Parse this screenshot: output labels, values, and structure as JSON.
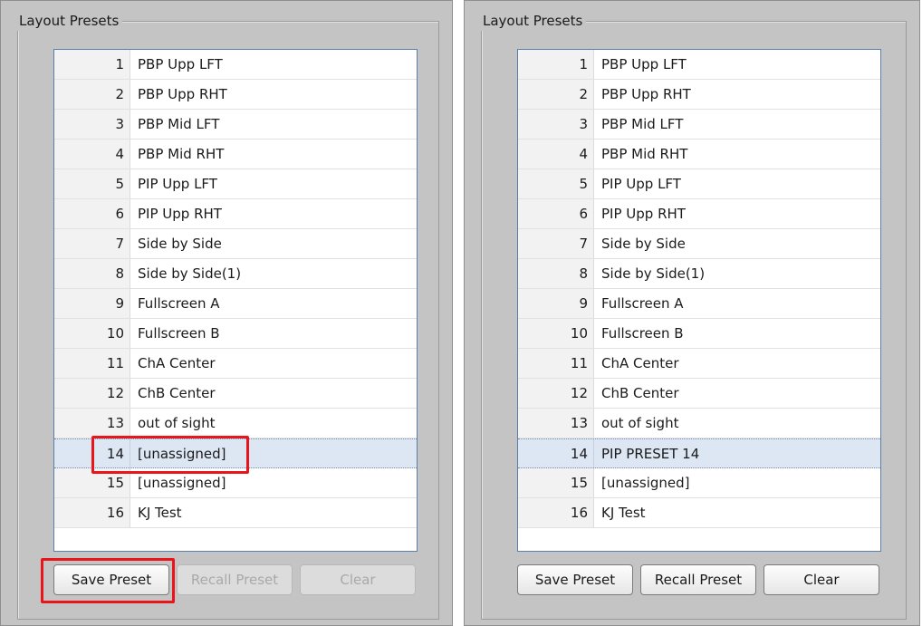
{
  "left_panel": {
    "group_title": "Layout Presets",
    "presets": [
      {
        "num": "1",
        "name": "PBP Upp LFT"
      },
      {
        "num": "2",
        "name": "PBP Upp RHT"
      },
      {
        "num": "3",
        "name": "PBP Mid LFT"
      },
      {
        "num": "4",
        "name": "PBP Mid RHT"
      },
      {
        "num": "5",
        "name": "PIP Upp LFT"
      },
      {
        "num": "6",
        "name": "PIP Upp RHT"
      },
      {
        "num": "7",
        "name": "Side by Side"
      },
      {
        "num": "8",
        "name": "Side by Side(1)"
      },
      {
        "num": "9",
        "name": "Fullscreen A"
      },
      {
        "num": "10",
        "name": "Fullscreen B"
      },
      {
        "num": "11",
        "name": "ChA Center"
      },
      {
        "num": "12",
        "name": "ChB Center"
      },
      {
        "num": "13",
        "name": "out of sight"
      },
      {
        "num": "14",
        "name": "[unassigned]"
      },
      {
        "num": "15",
        "name": "[unassigned]"
      },
      {
        "num": "16",
        "name": "KJ Test"
      }
    ],
    "selected_row": "14",
    "buttons": {
      "save": "Save Preset",
      "recall": "Recall Preset",
      "clear": "Clear"
    },
    "recall_enabled": false,
    "clear_enabled": false
  },
  "right_panel": {
    "group_title": "Layout Presets",
    "presets": [
      {
        "num": "1",
        "name": "PBP Upp LFT"
      },
      {
        "num": "2",
        "name": "PBP Upp RHT"
      },
      {
        "num": "3",
        "name": "PBP Mid LFT"
      },
      {
        "num": "4",
        "name": "PBP Mid RHT"
      },
      {
        "num": "5",
        "name": "PIP Upp LFT"
      },
      {
        "num": "6",
        "name": "PIP Upp RHT"
      },
      {
        "num": "7",
        "name": "Side by Side"
      },
      {
        "num": "8",
        "name": "Side by Side(1)"
      },
      {
        "num": "9",
        "name": "Fullscreen A"
      },
      {
        "num": "10",
        "name": "Fullscreen B"
      },
      {
        "num": "11",
        "name": "ChA Center"
      },
      {
        "num": "12",
        "name": "ChB Center"
      },
      {
        "num": "13",
        "name": "out of sight"
      },
      {
        "num": "14",
        "name": "PIP PRESET 14"
      },
      {
        "num": "15",
        "name": "[unassigned]"
      },
      {
        "num": "16",
        "name": "KJ Test"
      }
    ],
    "selected_row": "14",
    "buttons": {
      "save": "Save Preset",
      "recall": "Recall Preset",
      "clear": "Clear"
    },
    "recall_enabled": true,
    "clear_enabled": true
  },
  "colors": {
    "highlight": "#e8151b",
    "selection": "#dde6f3",
    "panel_bg": "#c4c4c4"
  }
}
